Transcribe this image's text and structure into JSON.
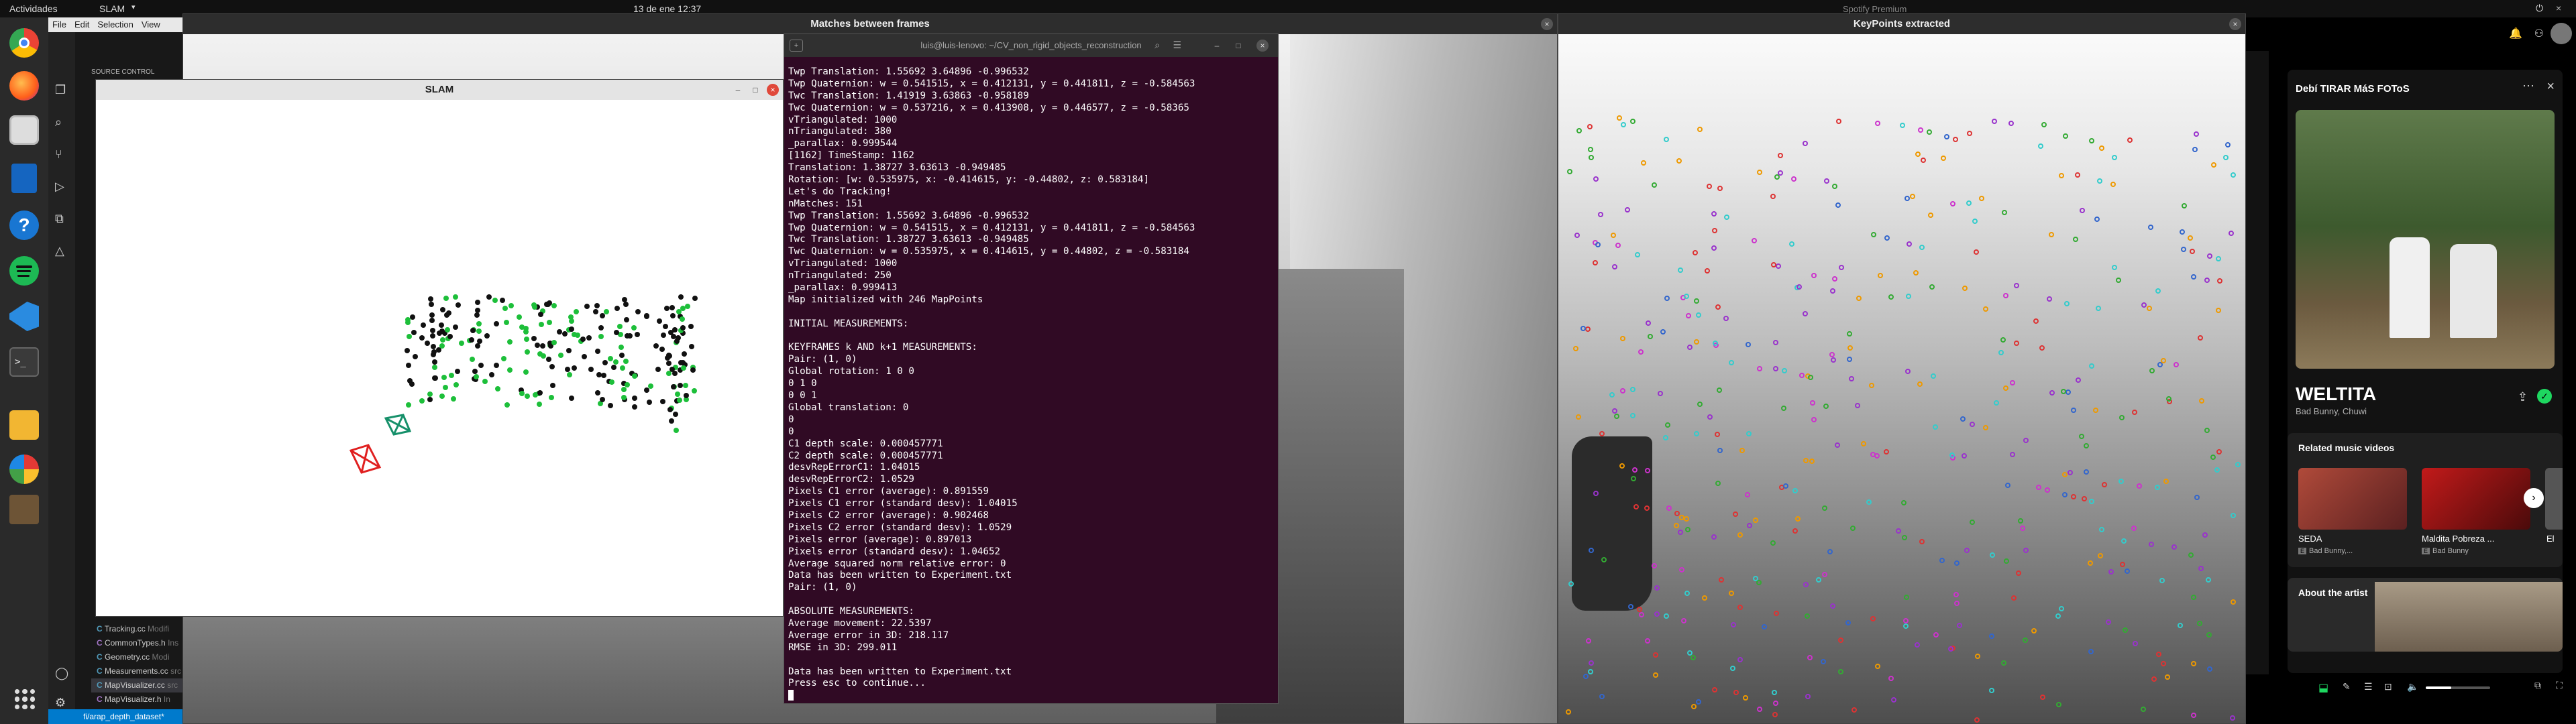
{
  "topbar": {
    "activities": "Actividades",
    "app_menu": "SLAM",
    "clock": "13 de ene  12:37",
    "spotify_partial_title": "Spotify Premium"
  },
  "dock": {
    "items": [
      "chrome-icon",
      "firefox-icon",
      "files-icon",
      "writer-icon",
      "help-icon",
      "spotify-icon",
      "vscode-icon",
      "terminal-icon",
      "files-yellow-icon",
      "color-icon",
      "image-icon"
    ],
    "apps_grid": "apps-grid-icon"
  },
  "vscode": {
    "menu": [
      "File",
      "Edit",
      "Selection",
      "View"
    ],
    "source_control": "SOURCE CONTROL",
    "files": [
      {
        "icon": "C",
        "name": "Tracking.cc",
        "tag": "Modifi"
      },
      {
        "icon": "C",
        "name": "CommonTypes.h",
        "tag": "Ins"
      },
      {
        "icon": "C",
        "name": "Geometry.cc",
        "tag": "Modi"
      },
      {
        "icon": "C",
        "name": "Measurements.cc",
        "tag": "src"
      },
      {
        "icon": "C",
        "name": "MapVisualizer.cc",
        "tag": "src"
      },
      {
        "icon": "C",
        "name": "MapVisualizer.h",
        "tag": "In"
      }
    ],
    "status_branch": "fi/arap_depth_dataset*"
  },
  "slam_window": {
    "title": "SLAM",
    "close": "×",
    "minimize": "–",
    "maximize": "□"
  },
  "matches_window": {
    "title": "Matches between frames",
    "close": "×"
  },
  "terminal": {
    "title": "luis@luis-lenovo: ~/CV_non_rigid_objects_reconstruction",
    "close": "×",
    "minimize": "–",
    "maximize": "□",
    "lines": [
      "Twp Translation: 1.55692 3.64896 -0.996532",
      "Twp Quaternion: w = 0.541515, x = 0.412131, y = 0.441811, z = -0.584563",
      "Twc Translation: 1.41919 3.63863 -0.958189",
      "Twc Quaternion: w = 0.537216, x = 0.413908, y = 0.446577, z = -0.58365",
      "vTriangulated: 1000",
      "nTriangulated: 380",
      "_parallax: 0.999544",
      "[1162] TimeStamp: 1162",
      "Translation: 1.38727 3.63613 -0.949485",
      "Rotation: [w: 0.535975, x: -0.414615, y: -0.44802, z: 0.583184]",
      "Let's do Tracking!",
      "nMatches: 151",
      "Twp Translation: 1.55692 3.64896 -0.996532",
      "Twp Quaternion: w = 0.541515, x = 0.412131, y = 0.441811, z = -0.584563",
      "Twc Translation: 1.38727 3.63613 -0.949485",
      "Twc Quaternion: w = 0.535975, x = 0.414615, y = 0.44802, z = -0.583184",
      "vTriangulated: 1000",
      "nTriangulated: 250",
      "_parallax: 0.999413",
      "Map initialized with 246 MapPoints",
      "",
      "INITIAL MEASUREMENTS:",
      "",
      "KEYFRAMES k AND k+1 MEASUREMENTS:",
      "Pair: (1, 0)",
      "Global rotation: 1 0 0",
      "0 1 0",
      "0 0 1",
      "Global translation: 0",
      "0",
      "0",
      "C1 depth scale: 0.000457771",
      "C2 depth scale: 0.000457771",
      "desvRepErrorC1: 1.04015",
      "desvRepErrorC2: 1.0529",
      "Pixels C1 error (average): 0.891559",
      "Pixels C1 error (standard desv): 1.04015",
      "Pixels C2 error (average): 0.902468",
      "Pixels C2 error (standard desv): 1.0529",
      "Pixels error (average): 0.897013",
      "Pixels error (standard desv): 1.04652",
      "Average squared norm relative error: 0",
      "Data has been written to Experiment.txt",
      "Pair: (1, 0)",
      "",
      "ABSOLUTE MEASUREMENTS:",
      "Average movement: 22.5397",
      "Average error in 3D: 218.117",
      "RMSE in 3D: 299.011",
      "",
      "Data has been written to Experiment.txt",
      "Press esc to continue..."
    ]
  },
  "keypoints_window": {
    "title": "KeyPoints extracted",
    "close": "×"
  },
  "spotify": {
    "header_title": "Debí TIRAR MáS FOToS",
    "more": "⋯",
    "close": "×",
    "song_title": "WELTITA",
    "song_artists": "Bad Bunny, Chuwi",
    "related_heading": "Related music videos",
    "videos": [
      {
        "title": "SEDA",
        "artist": "Bad Bunny,..."
      },
      {
        "title": "Maldita Pobreza ...",
        "artist": "Bad Bunny"
      },
      {
        "title": "El",
        "artist": ""
      }
    ],
    "about_artist": "About the artist",
    "accent": "#1ed760"
  }
}
